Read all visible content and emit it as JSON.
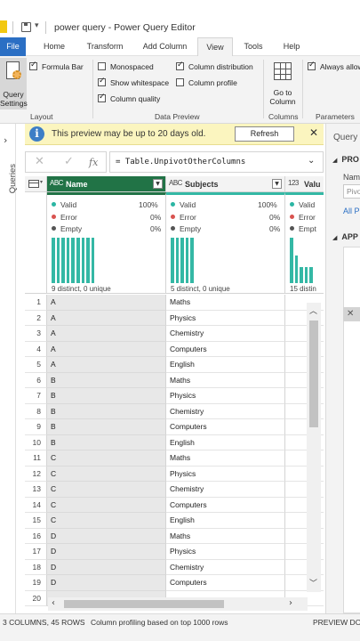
{
  "window": {
    "title": "power query - Power Query Editor",
    "qa_caret": "▾"
  },
  "tabs": [
    {
      "label": "File"
    },
    {
      "label": "Home"
    },
    {
      "label": "Transform"
    },
    {
      "label": "Add Column"
    },
    {
      "label": "View",
      "active": true
    },
    {
      "label": "Tools"
    },
    {
      "label": "Help"
    }
  ],
  "ribbon": {
    "query_settings_line1": "Query",
    "query_settings_line2": "Settings",
    "formula_bar": {
      "label": "Formula Bar",
      "checked": true
    },
    "monospaced": {
      "label": "Monospaced",
      "checked": false
    },
    "show_whitespace": {
      "label": "Show whitespace",
      "checked": true
    },
    "column_quality": {
      "label": "Column quality",
      "checked": true
    },
    "column_distribution": {
      "label": "Column distribution",
      "checked": true
    },
    "column_profile": {
      "label": "Column profile",
      "checked": false
    },
    "go_to_column_line1": "Go to",
    "go_to_column_line2": "Column",
    "always_allow": {
      "label": "Always allow",
      "checked": true
    },
    "groups": {
      "layout": "Layout",
      "data_preview": "Data Preview",
      "columns": "Columns",
      "parameters": "Parameters"
    }
  },
  "infobar": {
    "message": "This preview may be up to 20 days old.",
    "refresh_label": "Refresh",
    "close_glyph": "✕"
  },
  "queries_pane": {
    "label": "Queries",
    "expand_glyph": "›"
  },
  "formula": {
    "cancel_glyph": "✕",
    "commit_glyph": "✓",
    "fx_glyph": "fx",
    "text": "= Table.UnpivotOtherColumns",
    "expand_glyph": "⌄"
  },
  "columns": [
    {
      "name": "Name",
      "type": "ABC",
      "selected": true,
      "valid": "Valid",
      "valid_pct": "100%",
      "error": "Error",
      "error_pct": "0%",
      "empty": "Empty",
      "empty_pct": "0%",
      "distinct": "9 distinct, 0 unique"
    },
    {
      "name": "Subjects",
      "type": "ABC",
      "selected": false,
      "valid": "Valid",
      "valid_pct": "100%",
      "error": "Error",
      "error_pct": "0%",
      "empty": "Empty",
      "empty_pct": "0%",
      "distinct": "5 distinct, 0 unique"
    },
    {
      "name": "Valu",
      "type": "123",
      "selected": false,
      "valid": "Valid",
      "valid_pct": "",
      "error": "Error",
      "error_pct": "",
      "empty": "Empt",
      "empty_pct": "",
      "distinct": "15 distin"
    }
  ],
  "distribution": {
    "name_bars": [
      1,
      1,
      1,
      1,
      1,
      1,
      1,
      1,
      1
    ],
    "subjects_bars": [
      1,
      1,
      1,
      1,
      1
    ],
    "value_bars": [
      1,
      0.6,
      0.35,
      0.35,
      0.35
    ]
  },
  "rows": [
    {
      "n": "1",
      "name": "A",
      "subject": "Maths"
    },
    {
      "n": "2",
      "name": "A",
      "subject": "Physics"
    },
    {
      "n": "3",
      "name": "A",
      "subject": "Chemistry"
    },
    {
      "n": "4",
      "name": "A",
      "subject": "Computers"
    },
    {
      "n": "5",
      "name": "A",
      "subject": "English"
    },
    {
      "n": "6",
      "name": "B",
      "subject": "Maths"
    },
    {
      "n": "7",
      "name": "B",
      "subject": "Physics"
    },
    {
      "n": "8",
      "name": "B",
      "subject": "Chemistry"
    },
    {
      "n": "9",
      "name": "B",
      "subject": "Computers"
    },
    {
      "n": "10",
      "name": "B",
      "subject": "English"
    },
    {
      "n": "11",
      "name": "C",
      "subject": "Maths"
    },
    {
      "n": "12",
      "name": "C",
      "subject": "Physics"
    },
    {
      "n": "13",
      "name": "C",
      "subject": "Chemistry"
    },
    {
      "n": "14",
      "name": "C",
      "subject": "Computers"
    },
    {
      "n": "15",
      "name": "C",
      "subject": "English"
    },
    {
      "n": "16",
      "name": "D",
      "subject": "Maths"
    },
    {
      "n": "17",
      "name": "D",
      "subject": "Physics"
    },
    {
      "n": "18",
      "name": "D",
      "subject": "Chemistry"
    },
    {
      "n": "19",
      "name": "D",
      "subject": "Computers"
    },
    {
      "n": "20",
      "name": "",
      "subject": ""
    }
  ],
  "settings_pane": {
    "title": "Query",
    "properties": "PRO",
    "name_label": "Nam",
    "name_value": "Pivo",
    "all_properties": "All P",
    "applied_steps": "APP",
    "step_delete_glyph": "✕"
  },
  "statusbar": {
    "columns_rows": "3 COLUMNS, 45 ROWS",
    "profiling": "Column profiling based on top 1000 rows",
    "preview": "PREVIEW DO"
  },
  "colors": {
    "file_tab": "#2b6fc4",
    "selected_column_header": "#217346",
    "distribution_bar": "#34b8a5",
    "valid_dot": "#2bb6a3",
    "error_dot": "#d9534f",
    "empty_dot": "#555555",
    "infobar_bg": "#fbf5bf"
  }
}
